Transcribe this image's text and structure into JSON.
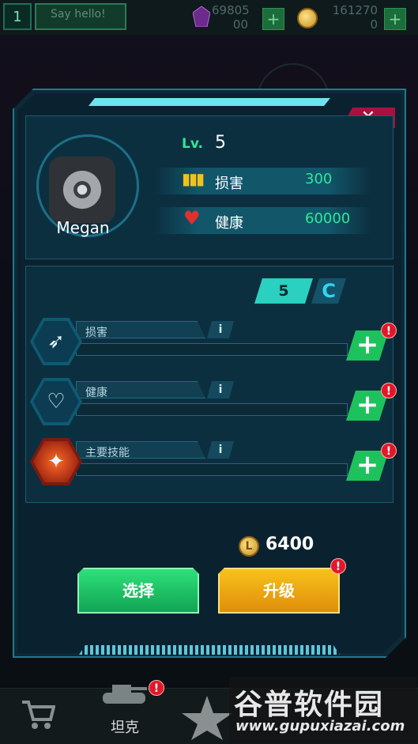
{
  "topbar": {
    "level": "1",
    "chat_label": "Say hello!",
    "gems": "69805\n00",
    "coins": "161270\n0",
    "plus": "+"
  },
  "dialog": {
    "close": "✕",
    "hero_name": "Megan",
    "level_label": "Lv.",
    "level_value": "5",
    "stats": [
      {
        "label": "损害",
        "value": "300"
      },
      {
        "label": "健康",
        "value": "60000"
      }
    ],
    "refresh_count": "5",
    "refresh_icon": "C",
    "attributes": [
      {
        "label": "损害",
        "info": "i",
        "plus": "+",
        "alert": "!"
      },
      {
        "label": "健康",
        "info": "i",
        "plus": "+",
        "alert": "!"
      },
      {
        "label": "主要技能",
        "info": "i",
        "plus": "+",
        "alert": "!"
      }
    ],
    "cost": "6400",
    "coin_symbol": "L",
    "select_label": "选择",
    "upgrade_label": "升级",
    "upgrade_alert": "!"
  },
  "bottomnav": {
    "tank_label": "坦克",
    "tank_alert": "!"
  },
  "watermark": {
    "title": "谷普软件园",
    "url": "www.gupuxiazai.com"
  },
  "colors": {
    "accent_green": "#2ee89a",
    "gold": "#f2c21a",
    "close_red": "#a8103e"
  }
}
